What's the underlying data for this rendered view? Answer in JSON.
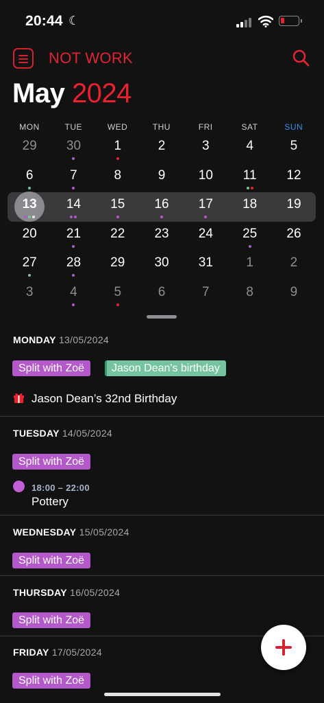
{
  "status_bar": {
    "time": "20:44"
  },
  "header": {
    "calendar_name": "NOT WORK"
  },
  "month": {
    "name": "May",
    "year": "2024"
  },
  "weekdays": [
    "MON",
    "TUE",
    "WED",
    "THU",
    "FRI",
    "SAT",
    "SUN"
  ],
  "colors": {
    "accent": "#e8232f",
    "purple": "#b359c9",
    "green": "#75c49f",
    "red": "#e8232f",
    "sunday": "#3b8de8"
  },
  "weeks": [
    [
      {
        "n": "29",
        "o": true
      },
      {
        "n": "30",
        "o": true,
        "d": [
          "purple"
        ]
      },
      {
        "n": "1",
        "d": [
          "red"
        ]
      },
      {
        "n": "2"
      },
      {
        "n": "3"
      },
      {
        "n": "4"
      },
      {
        "n": "5"
      }
    ],
    [
      {
        "n": "6",
        "d": [
          "green"
        ]
      },
      {
        "n": "7",
        "d": [
          "purple"
        ]
      },
      {
        "n": "8"
      },
      {
        "n": "9"
      },
      {
        "n": "10"
      },
      {
        "n": "11",
        "d": [
          "green",
          "red"
        ]
      },
      {
        "n": "12"
      }
    ],
    [
      {
        "n": "13",
        "today": true,
        "d": [
          "purple",
          "green",
          "gift"
        ]
      },
      {
        "n": "14",
        "d": [
          "purple",
          "purple"
        ]
      },
      {
        "n": "15",
        "d": [
          "purple"
        ]
      },
      {
        "n": "16",
        "d": [
          "purple"
        ]
      },
      {
        "n": "17",
        "d": [
          "purple"
        ]
      },
      {
        "n": "18"
      },
      {
        "n": "19"
      }
    ],
    [
      {
        "n": "20"
      },
      {
        "n": "21",
        "d": [
          "purple"
        ]
      },
      {
        "n": "22"
      },
      {
        "n": "23"
      },
      {
        "n": "24"
      },
      {
        "n": "25",
        "d": [
          "purple"
        ]
      },
      {
        "n": "26"
      }
    ],
    [
      {
        "n": "27",
        "d": [
          "green"
        ]
      },
      {
        "n": "28",
        "d": [
          "purple"
        ]
      },
      {
        "n": "29"
      },
      {
        "n": "30"
      },
      {
        "n": "31"
      },
      {
        "n": "1",
        "o": true
      },
      {
        "n": "2",
        "o": true
      }
    ],
    [
      {
        "n": "3",
        "o": true
      },
      {
        "n": "4",
        "o": true,
        "d": [
          "purple"
        ]
      },
      {
        "n": "5",
        "o": true,
        "d": [
          "red"
        ]
      },
      {
        "n": "6",
        "o": true
      },
      {
        "n": "7",
        "o": true
      },
      {
        "n": "8",
        "o": true
      },
      {
        "n": "9",
        "o": true
      }
    ]
  ],
  "agenda": {
    "monday": {
      "day": "MONDAY",
      "date": "13/05/2024",
      "chip1": "Split with Zoë",
      "chip2": "Jason Dean's birthday",
      "event": "Jason Dean’s 32nd Birthday"
    },
    "tuesday": {
      "day": "TUESDAY",
      "date": "14/05/2024",
      "chip1": "Split with Zoë",
      "event_time": "18:00 – 22:00",
      "event": "Pottery"
    },
    "wednesday": {
      "day": "WEDNESDAY",
      "date": "15/05/2024",
      "chip1": "Split with Zoë"
    },
    "thursday": {
      "day": "THURSDAY",
      "date": "16/05/2024",
      "chip1": "Split with Zoë"
    },
    "friday": {
      "day": "FRIDAY",
      "date": "17/05/2024",
      "chip1": "Split with Zoë"
    }
  }
}
